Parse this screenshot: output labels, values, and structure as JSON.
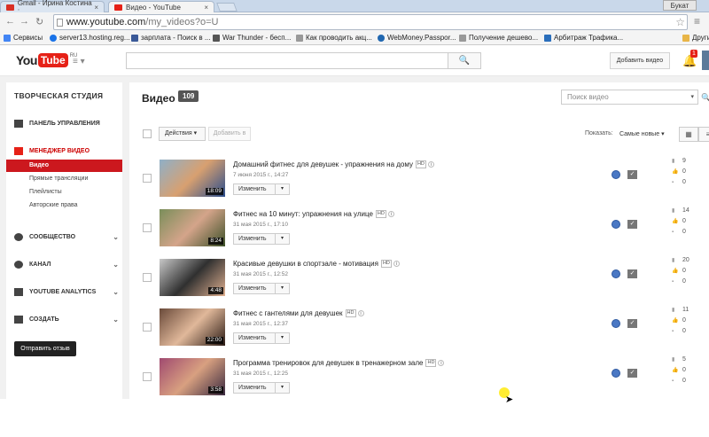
{
  "browser": {
    "tabs": [
      {
        "title": "Gmail - Ирина Костина :",
        "active": false,
        "icon": "gmail-icon",
        "color": "#d93025"
      },
      {
        "title": "Видео - YouTube",
        "active": true,
        "icon": "youtube-icon",
        "color": "#e62117"
      }
    ],
    "user_tag": "Букат",
    "url_host": "www.youtube.com",
    "url_path": "/my_videos?o=U",
    "bookmarks": [
      {
        "label": "Сервисы",
        "icon": "apps-icon",
        "color": "#4285f4"
      },
      {
        "label": "server13.hosting.reg...",
        "icon": "globe-icon",
        "color": "#1a73e8"
      },
      {
        "label": "зарплата - Поиск в ...",
        "icon": "search-icon",
        "color": "#3b5998"
      },
      {
        "label": "War Thunder - бесп...",
        "icon": "game-icon",
        "color": "#555555"
      },
      {
        "label": "Как проводить акц...",
        "icon": "page-icon",
        "color": "#999999"
      },
      {
        "label": "WebMoney.Passpor...",
        "icon": "webmoney-icon",
        "color": "#2067b0"
      },
      {
        "label": "Получение дешево...",
        "icon": "page-icon",
        "color": "#999999"
      },
      {
        "label": "Арбитраж Трафика...",
        "icon": "arbitrage-icon",
        "color": "#2a6ebb"
      },
      {
        "label": "Другие",
        "icon": "folder-icon",
        "color": "#e8b548"
      }
    ]
  },
  "youtube": {
    "logo_you": "You",
    "logo_tube": "Tube",
    "logo_region": "RU",
    "search_button": "🔍",
    "upload_button": "Добавить видео",
    "notification_count": "1"
  },
  "sidebar": {
    "title": "ТВОРЧЕСКАЯ СТУДИЯ",
    "dashboard": "ПАНЕЛЬ УПРАВЛЕНИЯ",
    "video_manager": "МЕНЕДЖЕР ВИДЕО",
    "sub_items": [
      "Видео",
      "Прямые трансляции",
      "Плейлисты",
      "Авторские права"
    ],
    "community": "СООБЩЕСТВО",
    "channel": "КАНАЛ",
    "analytics": "YOUTUBE ANALYTICS",
    "create": "СОЗДАТЬ",
    "feedback": "Отправить отзыв"
  },
  "main": {
    "title": "Видео",
    "video_count": "109",
    "search_placeholder": "Поиск видео",
    "actions_label": "Действия",
    "add_to_label": "Добавить в",
    "show_label": "Показать:",
    "sort_value": "Самые новые"
  },
  "videos": [
    {
      "title": "Домашний фитнес для девушек - упражнения на дому",
      "date": "7 июня 2015 г., 14:27",
      "duration": "18:09",
      "views": "9",
      "likes": "0",
      "comments": "0",
      "edit": "Изменить",
      "thumb": [
        "#8fb0c8",
        "#d8a070",
        "#2a4d8c"
      ]
    },
    {
      "title": "Фитнес на 10 минут: упражнения на улице",
      "date": "31 мая 2015 г., 17:10",
      "duration": "8:24",
      "views": "14",
      "likes": "0",
      "comments": "0",
      "edit": "Изменить",
      "thumb": [
        "#7a8e5a",
        "#d4a48a",
        "#3c5028"
      ]
    },
    {
      "title": "Красивые девушки в спортзале - мотивация",
      "date": "31 мая 2015 г., 12:52",
      "duration": "4:48",
      "views": "20",
      "likes": "0",
      "comments": "0",
      "edit": "Изменить",
      "thumb": [
        "#c8c8c8",
        "#303030",
        "#e0b090"
      ]
    },
    {
      "title": "Фитнес с гантелями для девушек",
      "date": "31 мая 2015 г., 12:37",
      "duration": "22:00",
      "views": "11",
      "likes": "0",
      "comments": "0",
      "edit": "Изменить",
      "thumb": [
        "#6a4a3a",
        "#e0b89a",
        "#2a1a14"
      ]
    },
    {
      "title": "Программа тренировок для девушек в тренажерном зале",
      "date": "31 мая 2015 г., 12:25",
      "duration": "3:58",
      "views": "5",
      "likes": "0",
      "comments": "0",
      "edit": "Изменить",
      "thumb": [
        "#a04a70",
        "#d8a080",
        "#3a2a40"
      ]
    }
  ]
}
